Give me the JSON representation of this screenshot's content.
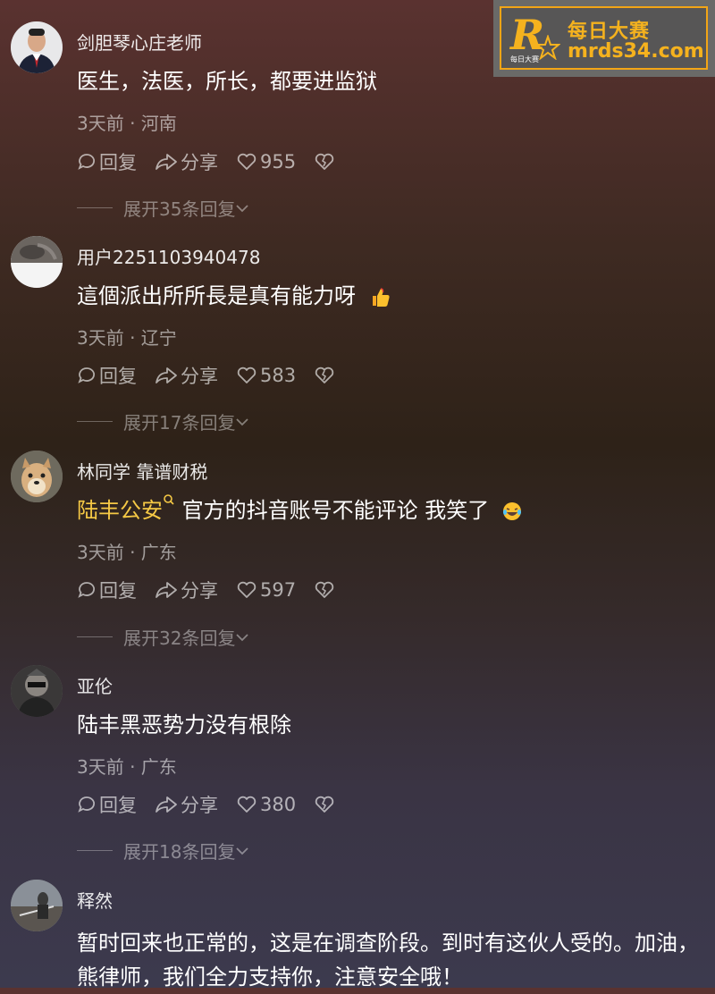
{
  "watermark": {
    "cn": "每日大赛",
    "url": "mrds34.com",
    "small": "每日大赛",
    "r_letter": "R"
  },
  "labels": {
    "reply": "回复",
    "share": "分享"
  },
  "comments": [
    {
      "user": "剑胆琴心庄老师",
      "text": "医生，法医，所长，都要进监狱",
      "meta": "3天前 · 河南",
      "likes": "955",
      "expand": "展开35条回复"
    },
    {
      "user": "用户2251103940478",
      "text": "這個派出所所長是真有能力呀",
      "meta": "3天前 · 辽宁",
      "likes": "583",
      "expand": "展开17条回复"
    },
    {
      "user": "林同学 靠谱财税",
      "mention": "陆丰公安",
      "text": "官方的抖音账号不能评论 我笑了",
      "meta": "3天前 · 广东",
      "likes": "597",
      "expand": "展开32条回复"
    },
    {
      "user": "亚伦",
      "text": "陆丰黑恶势力没有根除",
      "meta": "3天前 · 广东",
      "likes": "380",
      "expand": "展开18条回复"
    },
    {
      "user": "释然",
      "text": "暂时回来也正常的，这是在调查阶段。到时有这伙人受的。加油，熊律师，我们全力支持你，注意安全哦！"
    }
  ]
}
